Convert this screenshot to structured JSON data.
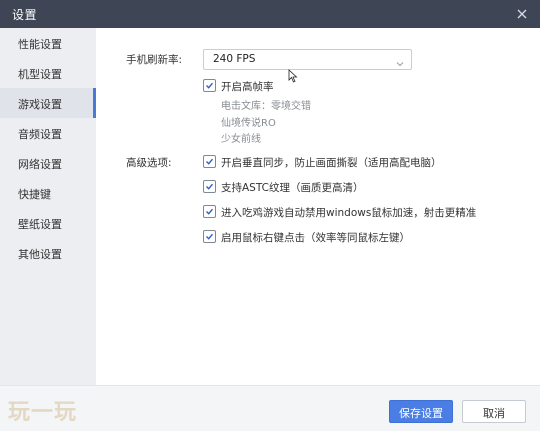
{
  "window": {
    "title": "设置"
  },
  "sidebar": {
    "items": [
      {
        "label": "性能设置",
        "active": false
      },
      {
        "label": "机型设置",
        "active": false
      },
      {
        "label": "游戏设置",
        "active": true
      },
      {
        "label": "音频设置",
        "active": false
      },
      {
        "label": "网络设置",
        "active": false
      },
      {
        "label": "快捷键",
        "active": false
      },
      {
        "label": "壁纸设置",
        "active": false
      },
      {
        "label": "其他设置",
        "active": false
      }
    ]
  },
  "main": {
    "fps_label": "手机刷新率:",
    "fps_value": "240 FPS",
    "high_fps": {
      "label": "开启高帧率",
      "checked": true,
      "games": [
        "电击文库：零境交错",
        "仙境传说RO",
        "少女前线"
      ]
    },
    "advanced_label": "高级选项:",
    "advanced_options": [
      {
        "label": "开启垂直同步，防止画面撕裂（适用高配电脑）",
        "checked": true
      },
      {
        "label": "支持ASTC纹理（画质更高清）",
        "checked": true
      },
      {
        "label": "进入吃鸡游戏自动禁用windows鼠标加速，射击更精准",
        "checked": true
      },
      {
        "label": "启用鼠标右键点击（效率等同鼠标左键）",
        "checked": true
      }
    ]
  },
  "footer": {
    "save_label": "保存设置",
    "cancel_label": "取消"
  },
  "watermark": "玩一玩",
  "colors": {
    "titlebar": "#3e4554",
    "accent": "#4b7ee4",
    "sidebar_bg": "#edeef1"
  },
  "icons": {
    "close": "close-icon",
    "caret": "chevron-down-icon",
    "check": "checkmark-icon",
    "cursor": "mouse-cursor-icon"
  }
}
